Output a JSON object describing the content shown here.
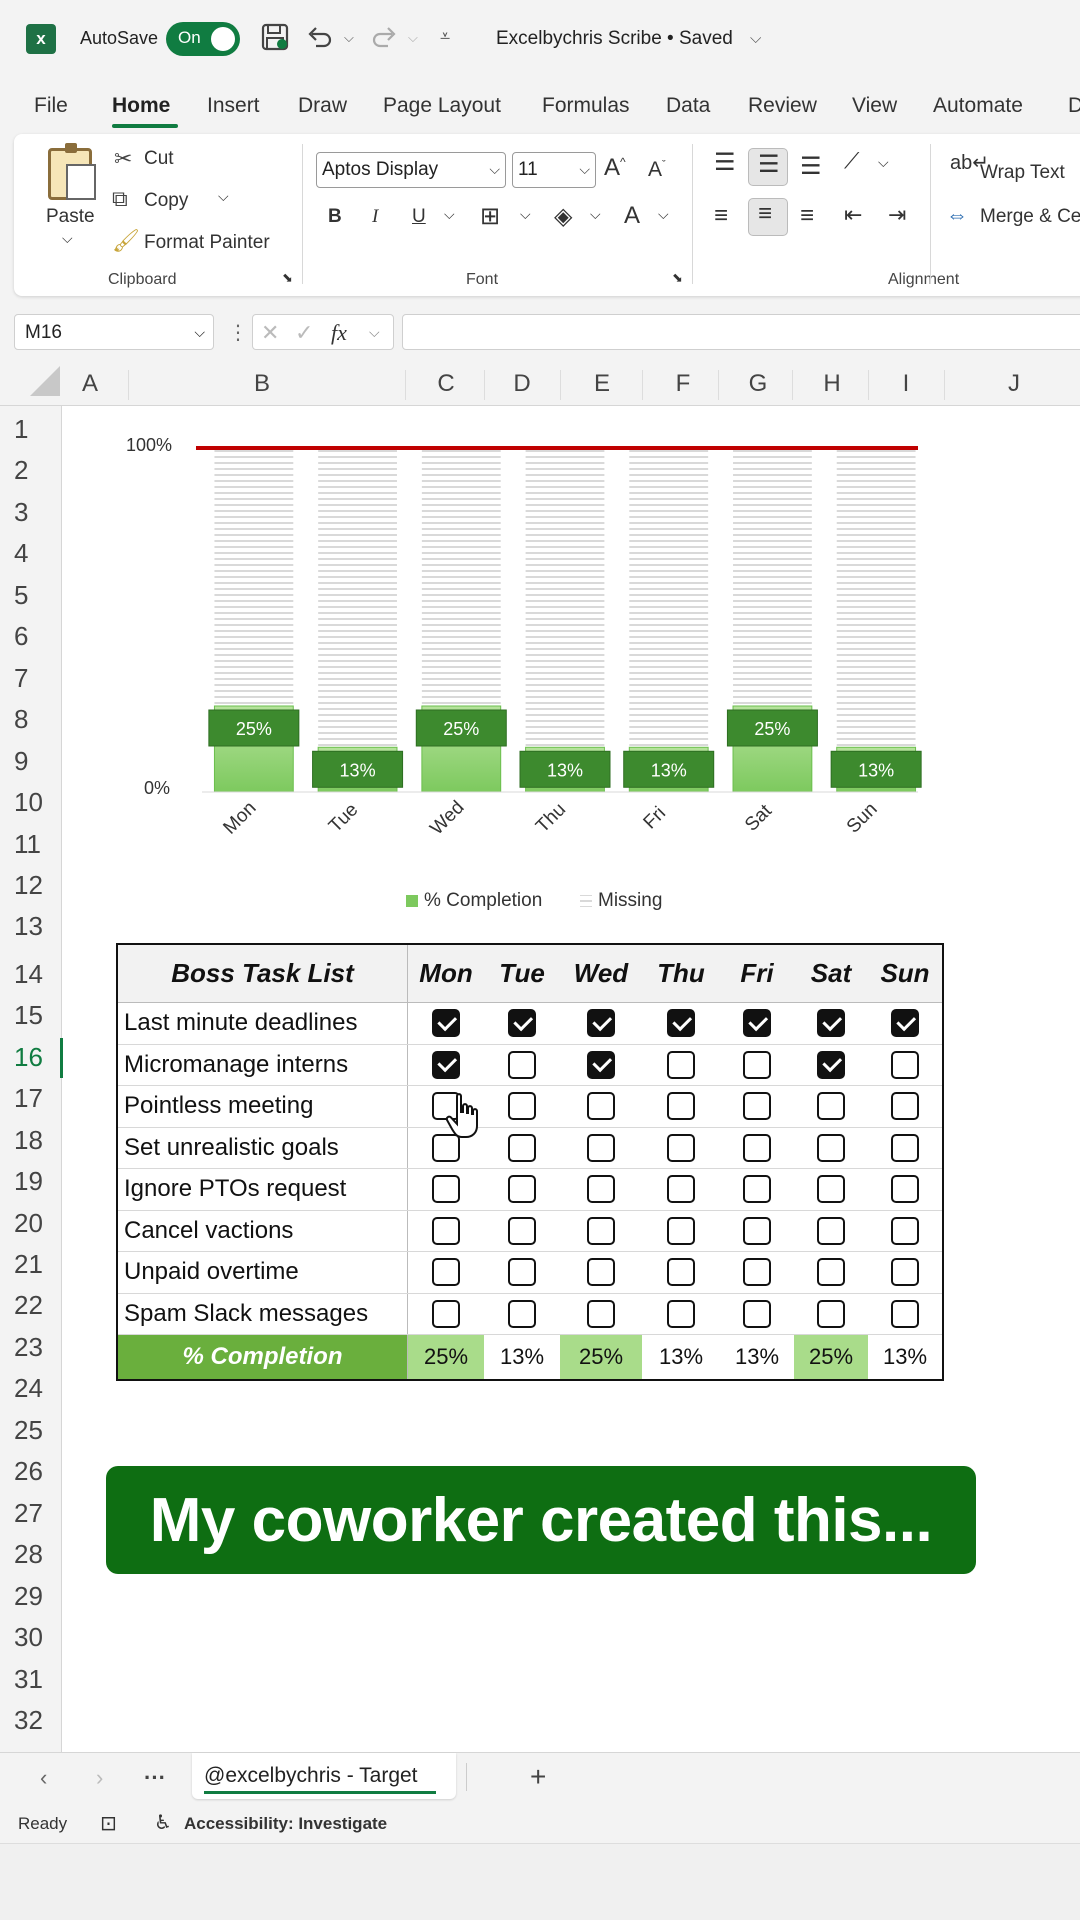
{
  "titlebar": {
    "app_icon": "excel-logo",
    "autosave_label": "AutoSave",
    "autosave_state": "On",
    "document_title": "Excelbychris Scribe • Saved"
  },
  "ribbon_tabs": [
    "File",
    "Home",
    "Insert",
    "Draw",
    "Page Layout",
    "Formulas",
    "Data",
    "Review",
    "View",
    "Automate",
    "D"
  ],
  "active_tab": "Home",
  "ribbon": {
    "clipboard": {
      "paste": "Paste",
      "cut": "Cut",
      "copy": "Copy",
      "format_painter": "Format Painter",
      "group_label": "Clipboard"
    },
    "font": {
      "font_name": "Aptos Display",
      "font_size": "11",
      "group_label": "Font"
    },
    "alignment": {
      "wrap_text": "Wrap Text",
      "merge": "Merge & Ce",
      "group_label": "Alignment"
    }
  },
  "formula_bar": {
    "name_box": "M16",
    "fx_label": "fx",
    "formula": ""
  },
  "columns": [
    "A",
    "B",
    "C",
    "D",
    "E",
    "F",
    "G",
    "H",
    "I",
    "J"
  ],
  "rows": [
    "1",
    "2",
    "3",
    "4",
    "5",
    "6",
    "7",
    "8",
    "9",
    "10",
    "11",
    "12",
    "13",
    "14",
    "15",
    "16",
    "17",
    "18",
    "19",
    "20",
    "21",
    "22",
    "23",
    "24",
    "25",
    "26",
    "27",
    "28",
    "29",
    "30",
    "31",
    "32"
  ],
  "selected_row": "16",
  "chart_data": {
    "type": "bar",
    "categories": [
      "Mon",
      "Tue",
      "Wed",
      "Thu",
      "Fri",
      "Sat",
      "Sun"
    ],
    "series": [
      {
        "name": "% Completion",
        "values": [
          25,
          13,
          25,
          13,
          13,
          25,
          13
        ],
        "color": "#7dc95e"
      },
      {
        "name": "Missing",
        "values": [
          75,
          87,
          75,
          87,
          87,
          75,
          87
        ],
        "color": "#d9d9d9"
      }
    ],
    "data_labels": [
      "25%",
      "13%",
      "25%",
      "13%",
      "13%",
      "25%",
      "13%"
    ],
    "y_tick_labels": [
      "0%",
      "100%"
    ],
    "ylim": [
      0,
      100
    ],
    "target_line": {
      "value": 100,
      "color": "#c00000"
    },
    "legend": [
      "% Completion",
      "Missing"
    ],
    "legend_position": "bottom",
    "label_color": "#3d8a2e"
  },
  "task_table": {
    "title": "Boss Task List",
    "days": [
      "Mon",
      "Tue",
      "Wed",
      "Thu",
      "Fri",
      "Sat",
      "Sun"
    ],
    "tasks": [
      {
        "name": "Last minute deadlines",
        "checks": [
          true,
          true,
          true,
          true,
          true,
          true,
          true
        ]
      },
      {
        "name": "Micromanage interns",
        "checks": [
          true,
          false,
          true,
          false,
          false,
          true,
          false
        ]
      },
      {
        "name": "Pointless meeting",
        "checks": [
          false,
          false,
          false,
          false,
          false,
          false,
          false
        ]
      },
      {
        "name": "Set unrealistic goals",
        "checks": [
          false,
          false,
          false,
          false,
          false,
          false,
          false
        ]
      },
      {
        "name": "Ignore PTOs request",
        "checks": [
          false,
          false,
          false,
          false,
          false,
          false,
          false
        ]
      },
      {
        "name": "Cancel vactions",
        "checks": [
          false,
          false,
          false,
          false,
          false,
          false,
          false
        ]
      },
      {
        "name": "Unpaid overtime",
        "checks": [
          false,
          false,
          false,
          false,
          false,
          false,
          false
        ]
      },
      {
        "name": "Spam Slack messages",
        "checks": [
          false,
          false,
          false,
          false,
          false,
          false,
          false
        ]
      }
    ],
    "completion_label": "% Completion",
    "completion": [
      "25%",
      "13%",
      "25%",
      "13%",
      "13%",
      "25%",
      "13%"
    ],
    "completion_highlight": [
      true,
      false,
      true,
      false,
      false,
      true,
      false
    ]
  },
  "caption": "My coworker created this...",
  "sheet_tabs": {
    "active": "@excelbychris - Target"
  },
  "status_bar": {
    "ready": "Ready",
    "accessibility": "Accessibility: Investigate"
  }
}
